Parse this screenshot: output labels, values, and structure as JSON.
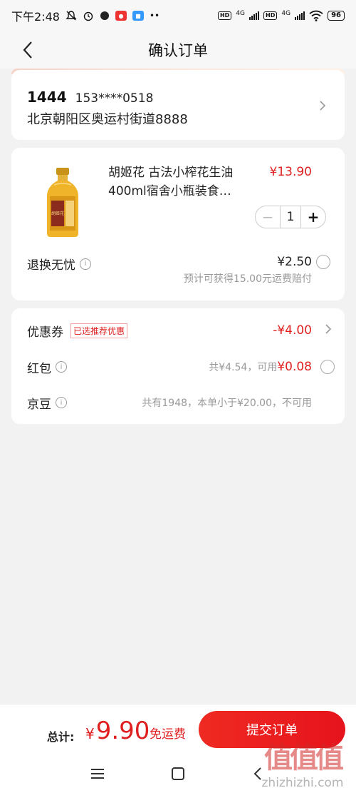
{
  "status": {
    "time": "下午2:48",
    "net1": "4G",
    "net2": "4G",
    "battery": "96"
  },
  "nav": {
    "title": "确认订单"
  },
  "address": {
    "name": "1444",
    "phone": "153****0518",
    "detail": "北京朝阳区奥运村街道8888"
  },
  "product": {
    "title": "胡姬花 古法小榨花生油400ml宿舍小瓶装食…",
    "price": "¥13.90",
    "quantity": "1",
    "image_brand": "胡姬花"
  },
  "service": {
    "label": "退换无忧",
    "price": "¥2.50",
    "note": "预计可获得15.00元运费赔付"
  },
  "promo": {
    "coupon_label": "优惠券",
    "coupon_tag": "已选推荐优惠",
    "coupon_value": "-¥4.00",
    "redpack_label": "红包",
    "redpack_note": "共¥4.54，可用",
    "redpack_value": "¥0.08",
    "jingdou_label": "京豆",
    "jingdou_note": "共有1948，本单小于¥20.00，不可用"
  },
  "bottom": {
    "total_label": "总计:",
    "currency": "¥",
    "total_amount": "9.90",
    "free_shipping": "免运费",
    "submit_label": "提交订单"
  },
  "watermark": {
    "logo": "值值值",
    "site": "zhizhizhi.com"
  },
  "colors": {
    "accent": "#e02020",
    "button": "#ee1c23",
    "background": "#f2f2f2"
  }
}
